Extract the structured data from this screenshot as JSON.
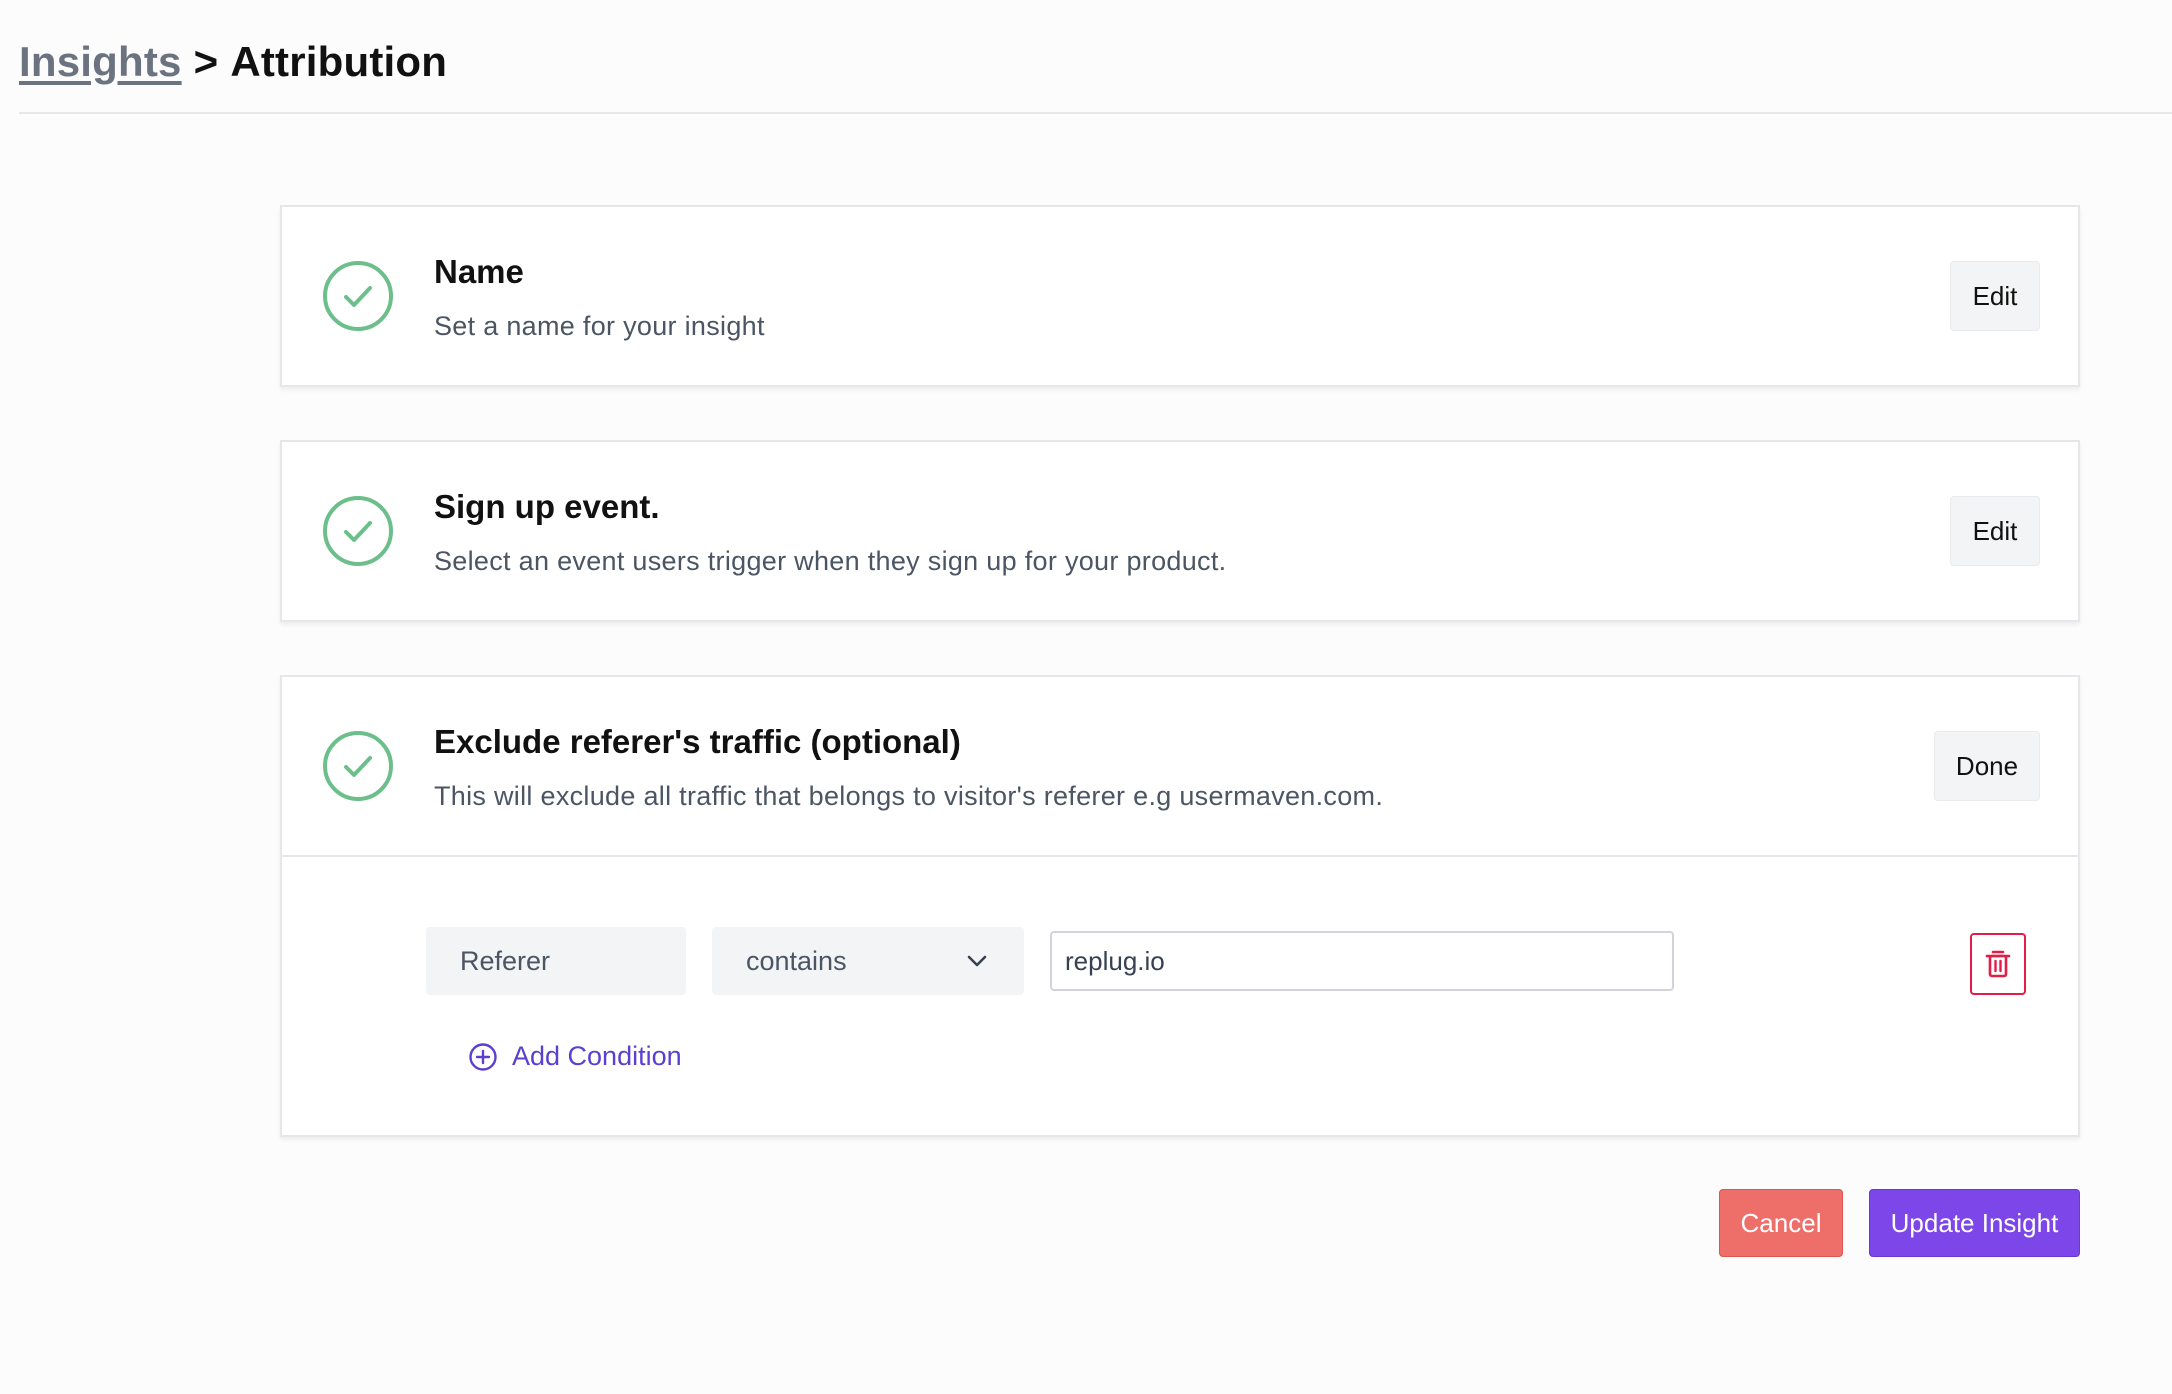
{
  "breadcrumb": {
    "parent": "Insights",
    "separator": ">",
    "current": "Attribution"
  },
  "steps": [
    {
      "title": "Name",
      "description": "Set a name for your insight",
      "button": "Edit",
      "status_icon": "check-circle-icon"
    },
    {
      "title": "Sign up event.",
      "description": "Select an event users trigger when they sign up for your product.",
      "button": "Edit",
      "status_icon": "check-circle-icon"
    },
    {
      "title": "Exclude referer's traffic (optional)",
      "description": "This will exclude all traffic that belongs to visitor's referer e.g usermaven.com.",
      "button": "Done",
      "status_icon": "check-circle-icon"
    }
  ],
  "condition": {
    "attribute": "Referer",
    "operator": "contains",
    "value": "replug.io",
    "delete_icon": "trash-icon"
  },
  "add_condition": {
    "label": "Add Condition",
    "icon": "plus-circle-icon"
  },
  "actions": {
    "cancel": "Cancel",
    "update": "Update Insight"
  },
  "colors": {
    "check": "#6cbf8a",
    "accent": "#7c46e8",
    "link": "#5b3fd1",
    "danger": "#ee6e6a",
    "delete": "#e11d48"
  }
}
